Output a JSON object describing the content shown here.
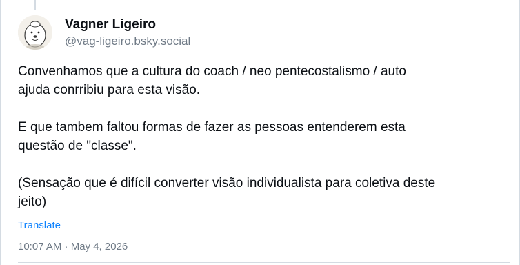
{
  "post": {
    "author": {
      "display_name": "Vagner Ligeiro",
      "handle": "@vag-ligeiro.bsky.social",
      "avatar_icon": "cartoon-seal-avatar-icon"
    },
    "paragraphs": [
      [
        "Convenhamos que a cultura do coach / neo pentecostalismo / auto",
        "ajuda conrribiu para esta visão."
      ],
      [
        "E que tambem faltou formas de fazer as pessoas entenderem esta",
        "questão de \"classe\"."
      ],
      [
        "(Sensação que é difícil converter visão individualista para coletiva deste",
        "jeito)"
      ]
    ],
    "translate_label": "Translate",
    "timestamp": "10:07 AM · May 4, 2026",
    "colors": {
      "link": "#1083fe",
      "muted": "#6f7a86",
      "border": "#d4dbe2"
    }
  }
}
